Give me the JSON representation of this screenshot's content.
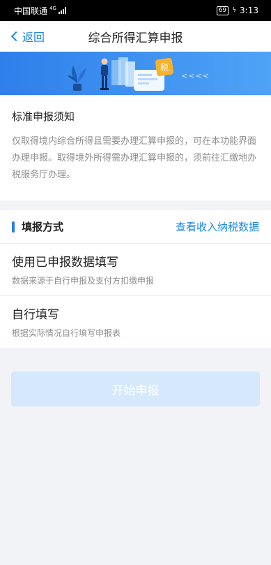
{
  "status_bar": {
    "carrier": "中国联通",
    "network": "4G",
    "battery": "69",
    "time": "3:13"
  },
  "header": {
    "back_label": "返回",
    "title": "综合所得汇算申报"
  },
  "banner": {
    "badge_text": "税",
    "arrows_text": "<<<<"
  },
  "notice": {
    "title": "标准申报须知",
    "body": "仅取得境内综合所得且需要办理汇算申报的，可在本功能界面办理申报。取得境外所得需办理汇算申报的，须前往汇缴地办税服务厅办理。"
  },
  "method": {
    "title": "填报方式",
    "link": "查看收入纳税数据",
    "options": [
      {
        "title": "使用已申报数据填写",
        "desc": "数据来源于自行申报及支付方扣缴申报"
      },
      {
        "title": "自行填写",
        "desc": "根据实际情况自行填写申报表"
      }
    ]
  },
  "start_button": {
    "label": "开始申报",
    "state": "disabled"
  },
  "colors": {
    "accent": "#1e88e5",
    "disabled_button": "#d6e9fc",
    "background": "#f2f3f7"
  }
}
